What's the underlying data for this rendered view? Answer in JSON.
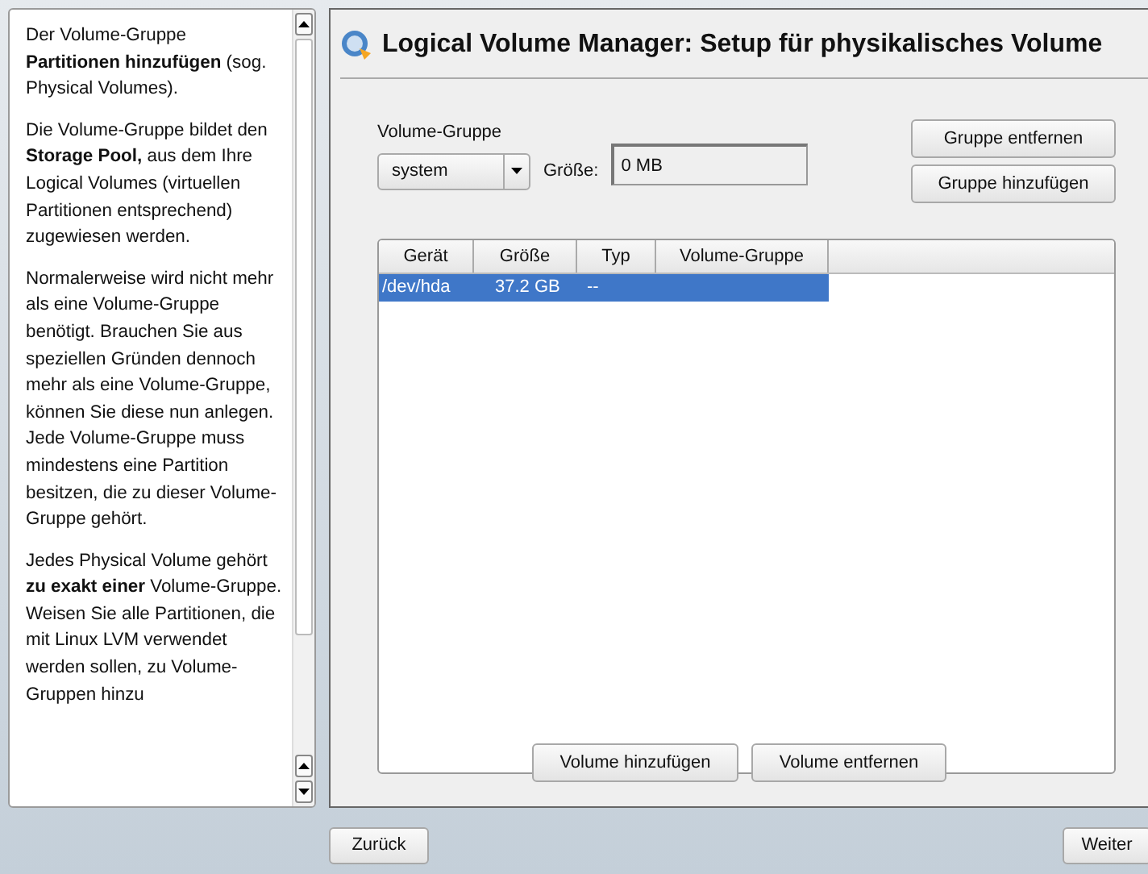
{
  "help": {
    "paragraphs": [
      "Der Volume-Gruppe **Partitionen hinzufügen** (sog. Physical Volumes).",
      "Die Volume-Gruppe bildet den **Storage Pool,** aus dem Ihre Logical Volumes (virtuellen Partitionen entsprechend) zugewiesen werden.",
      "Normalerweise wird nicht mehr als eine Volume-Gruppe benötigt. Brauchen Sie aus speziellen Gründen dennoch mehr als eine Volume-Gruppe, können Sie diese nun anlegen. Jede Volume-Gruppe muss mindestens eine Partition besitzen, die zu dieser Volume-Gruppe gehört.",
      "Jedes Physical Volume gehört **zu exakt einer** Volume-Gruppe. Weisen Sie alle Partitionen, die mit Linux LVM verwendet werden sollen, zu Volume-Gruppen hinzu"
    ]
  },
  "title": "Logical Volume Manager: Setup für physikalisches Volume",
  "volume_group": {
    "label": "Volume-Gruppe",
    "value": "system"
  },
  "size": {
    "label": "Größe:",
    "value": "0 MB"
  },
  "group_buttons": [
    "Gruppe entfernen",
    "Gruppe hinzufügen"
  ],
  "table": {
    "columns": [
      "Gerät",
      "Größe",
      "Typ",
      "Volume-Gruppe"
    ],
    "rows": [
      {
        "cells": [
          "/dev/hda",
          "37.2 GB",
          "--",
          ""
        ],
        "selected": true
      }
    ]
  },
  "volume_buttons": [
    "Volume hinzufügen",
    "Volume entfernen"
  ],
  "nav": {
    "back": "Zurück",
    "next": "Weiter"
  }
}
